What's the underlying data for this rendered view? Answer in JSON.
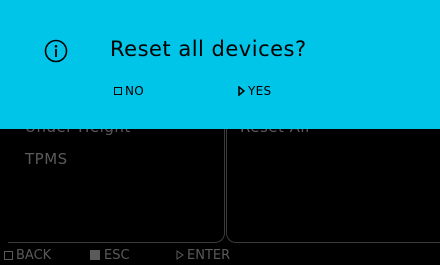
{
  "background": {
    "menu_items": [
      "Under Height",
      "TPMS"
    ],
    "right_items": [
      "Reset All"
    ]
  },
  "footer": {
    "back": "BACK",
    "esc": "ESC",
    "enter": "ENTER"
  },
  "dialog": {
    "title": "Reset all devices?",
    "no_label": "NO",
    "yes_label": "YES",
    "accent_color": "#00c4e8"
  }
}
